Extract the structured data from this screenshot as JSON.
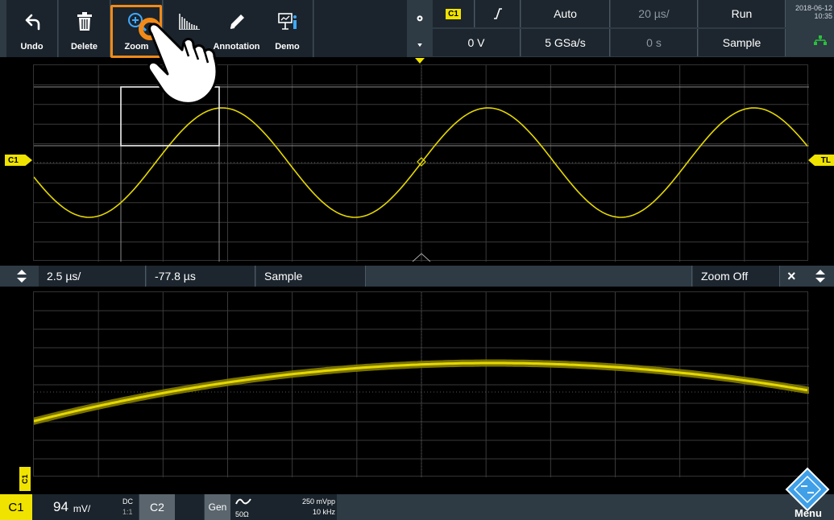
{
  "toolbar": {
    "buttons": [
      {
        "label": "Undo",
        "icon": "undo-icon"
      },
      {
        "label": "Delete",
        "icon": "trash-icon"
      },
      {
        "label": "Zoom",
        "icon": "zoom-icon"
      },
      {
        "label": "",
        "icon": "histogram-icon"
      },
      {
        "label": "Annotation",
        "icon": "pencil-icon"
      },
      {
        "label": "Demo",
        "icon": "demo-icon"
      }
    ]
  },
  "status": {
    "channel": "C1",
    "trigger_mode": "Auto",
    "timebase": "20 µs/",
    "run_state": "Run",
    "trigger_level": "0 V",
    "sample_rate": "5 GSa/s",
    "position": "0 s",
    "acq_mode": "Sample",
    "date": "2018-06-12",
    "time": "10:35"
  },
  "markers": {
    "channel_upper": "C1",
    "trigger_level": "TL",
    "trigger": "T",
    "channel_lower": "C1"
  },
  "zoom_bar": {
    "timebase": "2.5 µs/",
    "position": "-77.8 µs",
    "mode": "Sample",
    "zoom_off": "Zoom Off",
    "close": "×"
  },
  "bottom_bar": {
    "ch1_label": "C1",
    "ch1_scale": "94",
    "ch1_unit": "mV/",
    "ch1_coupling": "DC",
    "ch1_sub": "1:1",
    "ch2_label": "C2",
    "gen_label": "Gen",
    "gen_impedance": "50Ω",
    "gen_amplitude": "250 mVpp",
    "gen_frequency": "10 kHz",
    "menu_label": "Menu"
  },
  "colors": {
    "trace": "#e5d800",
    "accent_orange": "#f28a18",
    "toolbar_bg": "#1b242c"
  }
}
